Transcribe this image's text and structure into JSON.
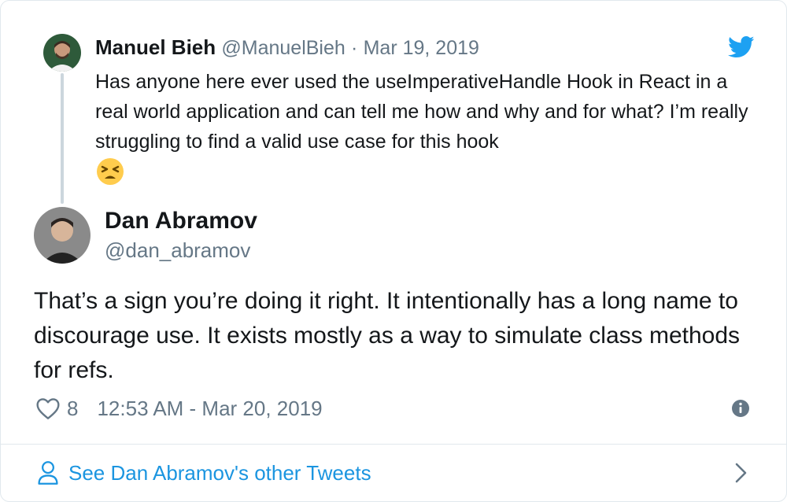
{
  "parent_tweet": {
    "author_name": "Manuel Bieh",
    "handle": "@ManuelBieh",
    "separator": "·",
    "date": "Mar 19, 2019",
    "text": "Has anyone here ever used the useImperativeHandle Hook in React in a real world application and can tell me how and why and for what? I’m really struggling to find a valid use case for this hook",
    "emoji_icon": "tired-face-emoji"
  },
  "main_tweet": {
    "author_name": "Dan Abramov",
    "handle": "@dan_abramov",
    "text": "That’s a sign you’re doing it right. It intentionally has a long name to discourage use. It exists mostly as a way to simulate class methods for refs.",
    "like_count": "8",
    "timestamp": "12:53 AM - Mar 20, 2019"
  },
  "footer": {
    "link_label": "See Dan Abramov's other Tweets"
  },
  "icons": {
    "brand": "twitter-bird-icon",
    "like": "heart-icon",
    "info": "info-icon",
    "profile": "person-icon",
    "next": "chevron-right-icon"
  },
  "colors": {
    "twitter_blue": "#1da1f2",
    "link_blue": "#1b95e0",
    "text_primary": "#14171a",
    "text_secondary": "#657786",
    "border": "#e1e8ed",
    "thread_line": "#ccd6dd"
  }
}
